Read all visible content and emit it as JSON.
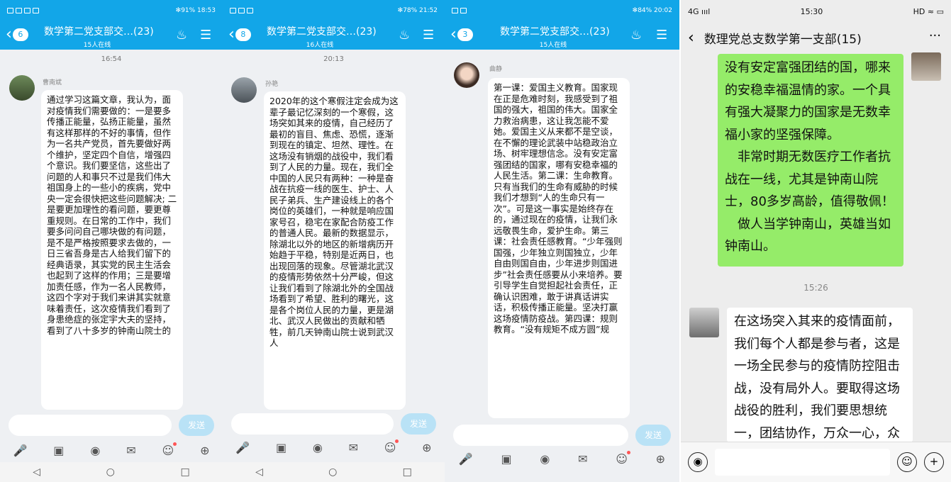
{
  "panels": [
    {
      "status_right": "✻91%  18:53",
      "unread": "6",
      "title": "数学第二党支部交…(23)",
      "online": "15人在线",
      "time": "16:54",
      "sender": "曹南斌",
      "send": "发送",
      "message": "通过学习这篇文章，我认为，面对疫情我们需要做的：一是要多传播正能量，弘扬正能量，虽然有这样那样的不好的事情，但作为一名共产党员，首先要做好两个维护，坚定四个自信，增强四个意识。我们要坚信，这些出了问题的人和事只不过是我们伟大祖国身上的一些小的疾病，党中央一定会很快把这些问题解决; 二是要更加理性的看问题，要更尊重规则。在日常的工作中，我们要多问问自己哪块做的有问题，是不是严格按照要求去做的，一日三省吾身是古人给我们留下的经典语录，其实党的民主生活会也起到了这样的作用；三是要增加责任感，作为一名人民教师，这四个字对于我们来讲其实就意味着责任，这次疫情我们看到了身患绝症的张定宇大夫的坚持，看到了八十多岁的钟南山院士的"
    },
    {
      "status_right": "✻78%  21:52",
      "unread": "8",
      "title": "数学第二党支部交…(23)",
      "online": "16人在线",
      "time": "20:13",
      "sender": "孙艳",
      "send": "发送",
      "message": "2020年的这个寒假注定会成为这辈子最记忆深刻的一个寒假，这场突如其来的疫情，自己经历了最初的盲目、焦虑、恐慌，逐渐到现在的镇定、坦然、理性。在这场没有销烟的战役中，我们看到了人民的力量。现在，我们全中国的人民只有两种：一种是奋战在抗疫一线的医生、护士、人民子弟兵、生产建设线上的各个岗位的英雄们，一种就是响应国家号召，稳宅在家配合防疫工作的普通人民。最新的数据显示，除湖北以外的地区的新增病历开始趋于平稳，特别是近两日，也出现回落的现象。尽管湖北武汉的疫情形势依然十分严峻，但这让我们看到了除湖北外的全国战场看到了希望、胜利的曙光，这是各个岗位人民的力量，更是湖北、武汉人民做出的贡献和牺牲，前几天钟南山院士说到武汉人"
    },
    {
      "status_right": "✻84%  20:02",
      "unread": "3",
      "title": "数学第二党支部交…(23)",
      "online": "15人在线",
      "time": "",
      "sender": "曲静",
      "send": "发送",
      "message": "第一课：爱国主义教育。国家现在正是危难时刻，我感受到了祖国的强大，祖国的伟大。国家全力救治病患，这让我怎能不爱她。爱国主义从来都不是空谈，在不懈的理论武装中站稳政治立场、树牢理想信念。没有安定富强团结的国家，哪有安稳幸福的人民生活。第二课：生命教育。只有当我们的生命有威胁的时候我们才想到“人的生命只有一次”。可是这一事实是始终存在的，通过现在的疫情，让我们永远敬畏生命，爱护生命。第三课：社会责任感教育。“少年强则国强，少年独立则国独立，少年自由则国自由，少年进步则国进步”社会责任感要从小来培养。要引导学生自觉担起社会责任，正确认识困难，敢于讲真话讲实话，积极传播正能量。坚决打赢这场疫情防疫战。第四课：规则教育。“没有规矩不成方圆”规"
    }
  ],
  "wechat": {
    "status_left": "4G ıııl",
    "status_time": "15:30",
    "status_right": "HD ≈ ▭",
    "title": "数理党总支数学第一支部(15)",
    "more": "···",
    "green_msg": "没有安定富强团结的国，哪来的安稳幸福温情的家。一个具有强大凝聚力的国家是无数幸福小家的坚强保障。\n　非常时期无数医疗工作者抗战在一线，尤其是钟南山院士，80多岁高龄，值得敬佩！\n　做人当学钟南山，英雄当如钟南山。",
    "time": "15:26",
    "white_msg": "在这场突入其来的疫情面前，我们每个人都是参与者，这是一场全民参与的疫情防控阻击战，没有局外人。要取得这场战役的胜利，我们要思想统一，团结协作，万众一心，众志成城"
  }
}
